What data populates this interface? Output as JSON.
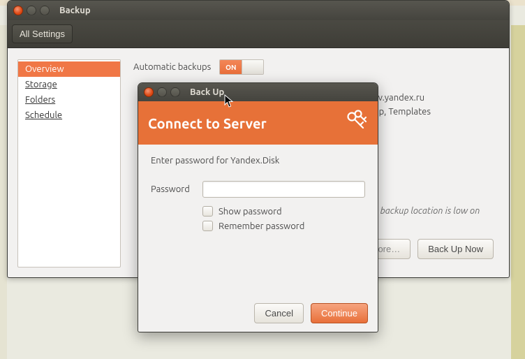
{
  "main": {
    "title": "Backup",
    "toolbar": {
      "all_settings": "All Settings"
    },
    "sidebar": {
      "items": [
        {
          "label": "Overview",
          "active": true
        },
        {
          "label": "Storage",
          "active": false
        },
        {
          "label": "Folders",
          "active": false
        },
        {
          "label": "Schedule",
          "active": false
        }
      ]
    },
    "pane": {
      "auto_label": "Automatic backups",
      "switch_state": "ON",
      "location_fragment": "av.yandex.ru",
      "folders_fragment": "op, Templates",
      "status_fragment": "e backup location is low on",
      "restore_btn": "tore…",
      "backup_btn": "Back Up Now"
    }
  },
  "dialog": {
    "title": "Back Up",
    "header": "Connect to Server",
    "prompt": "Enter password for Yandex.Disk",
    "password_label": "Password",
    "password_value": "",
    "show_password": "Show password",
    "remember_password": "Remember password",
    "cancel": "Cancel",
    "continue": "Continue"
  }
}
